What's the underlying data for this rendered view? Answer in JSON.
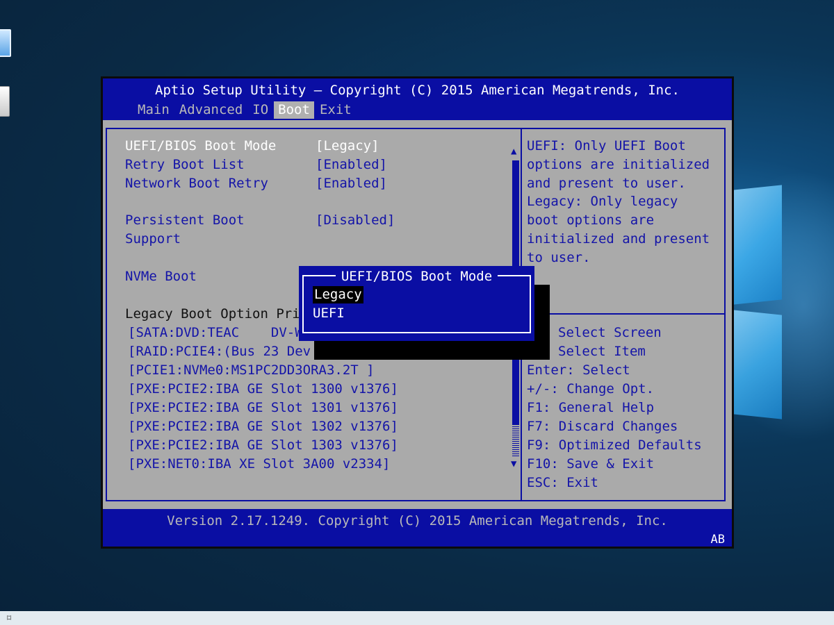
{
  "bios": {
    "title": "Aptio Setup Utility – Copyright (C) 2015 American Megatrends, Inc.",
    "tabs": [
      "Main",
      "Advanced",
      "IO",
      "Boot",
      "Exit"
    ],
    "active_tab": "Boot",
    "settings": [
      {
        "label": "UEFI/BIOS Boot Mode",
        "value": "[Legacy]"
      },
      {
        "label": "Retry Boot List",
        "value": "[Enabled]"
      },
      {
        "label": "Network Boot Retry",
        "value": "[Enabled]"
      },
      {
        "label": "Persistent Boot",
        "value": "[Disabled]"
      },
      {
        "label": "Support",
        "value": ""
      },
      {
        "label": "NVMe Boot",
        "value": ""
      }
    ],
    "legacy_heading": "Legacy Boot Option Pri",
    "boot_options": [
      "[SATA:DVD:TEAC    DV-W",
      "[RAID:PCIE4:(Bus 23 Dev",
      "[PCIE1:NVMe0:MS1PC2DD3ORA3.2T ]",
      "[PXE:PCIE2:IBA GE Slot 1300 v1376]",
      "[PXE:PCIE2:IBA GE Slot 1301 v1376]",
      "[PXE:PCIE2:IBA GE Slot 1302 v1376]",
      "[PXE:PCIE2:IBA GE Slot 1303 v1376]",
      "[PXE:NET0:IBA XE Slot 3A00 v2334]"
    ],
    "help_text": [
      "UEFI: Only UEFI Boot",
      "options are initialized",
      "and present to user.",
      "Legacy: Only legacy",
      "boot options are",
      "initialized and present",
      "to user."
    ],
    "key_help": [
      "Select Screen",
      "Select Item",
      "Enter: Select",
      "+/-: Change Opt.",
      "F1: General Help",
      "F7: Discard Changes",
      "F9: Optimized Defaults",
      "F10: Save & Exit",
      "ESC: Exit"
    ],
    "footer": "Version 2.17.1249. Copyright (C) 2015 American Megatrends, Inc.",
    "footer_badge": "AB",
    "popup": {
      "title": "UEFI/BIOS Boot Mode",
      "options": [
        "Legacy",
        "UEFI"
      ],
      "selected": "Legacy"
    }
  },
  "colors": {
    "bios_blue": "#0a0ea3",
    "panel_gray": "#aaaaaa",
    "text_blue": "#1414a8",
    "highlight": "#ffffff"
  }
}
